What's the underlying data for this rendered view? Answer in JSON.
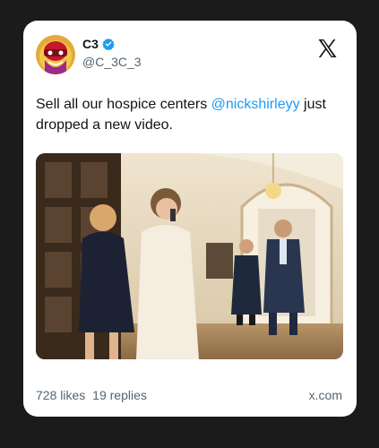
{
  "author": {
    "name": "C3",
    "handle": "@C_3C_3",
    "verified": true,
    "avatar_icon": "red-masked-figure-avatar"
  },
  "brand_icon": "x-logo-icon",
  "tweet": {
    "text_before": "Sell all our hospice centers ",
    "mention": "@nickshirleyy",
    "text_after": " just dropped a new video."
  },
  "media": {
    "kind": "photo"
  },
  "footer": {
    "likes": "728 likes",
    "replies": "19 replies",
    "source": "x.com"
  },
  "colors": {
    "mention": "#1d9bf0",
    "verified": "#1d9bf0",
    "muted_text": "#536471",
    "background": "#1b1b1b",
    "card": "#ffffff"
  }
}
